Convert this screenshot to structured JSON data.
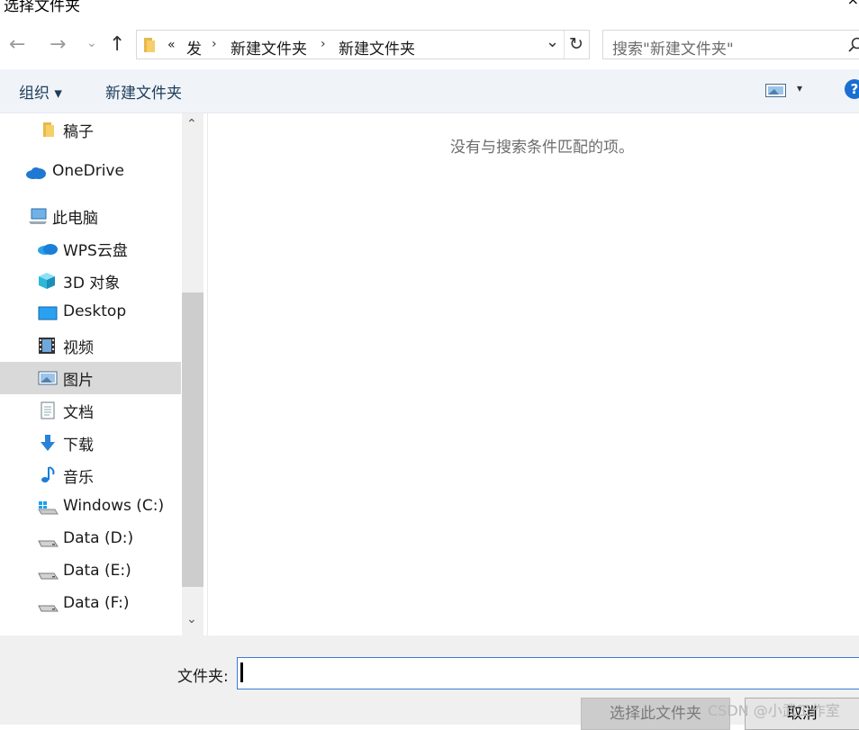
{
  "window": {
    "title": "选择文件夹",
    "close": "×"
  },
  "nav": {
    "back": "←",
    "forward": "→",
    "recent": "⌄",
    "up": "↑"
  },
  "breadcrumb": {
    "overflow": "«",
    "items": [
      "发",
      "新建文件夹",
      "新建文件夹"
    ],
    "sep": "›",
    "dropdown": "⌄",
    "refresh": "↻"
  },
  "search": {
    "placeholder": "搜索\"新建文件夹\""
  },
  "toolbar": {
    "organize_label": "组织 ▾",
    "new_folder_label": "新建文件夹",
    "view_menu": "▾",
    "help": "?"
  },
  "sidebar": {
    "items": [
      {
        "label": "稿子",
        "icon": "folder-icon"
      },
      {
        "label": "OneDrive",
        "icon": "cloud-icon"
      },
      {
        "label": "此电脑",
        "icon": "computer-icon"
      },
      {
        "label": "WPS云盘",
        "icon": "wps-cloud-icon"
      },
      {
        "label": "3D 对象",
        "icon": "cube-icon"
      },
      {
        "label": "Desktop",
        "icon": "desktop-icon"
      },
      {
        "label": "视频",
        "icon": "video-icon"
      },
      {
        "label": "图片",
        "icon": "picture-icon"
      },
      {
        "label": "文档",
        "icon": "document-icon"
      },
      {
        "label": "下载",
        "icon": "download-icon"
      },
      {
        "label": "音乐",
        "icon": "music-icon"
      },
      {
        "label": "Windows (C:)",
        "icon": "windows-drive-icon"
      },
      {
        "label": "Data (D:)",
        "icon": "drive-icon"
      },
      {
        "label": "Data (E:)",
        "icon": "drive-icon"
      },
      {
        "label": "Data (F:)",
        "icon": "drive-icon"
      }
    ],
    "selected": "图片",
    "scroll_up": "⌃",
    "scroll_down": "⌄"
  },
  "content": {
    "empty_message": "没有与搜索条件匹配的项。"
  },
  "footer": {
    "folder_label": "文件夹:",
    "folder_value": "",
    "select_button": "选择此文件夹",
    "cancel_button": "取消"
  },
  "watermark": "CSDN @小武工作室",
  "colors": {
    "accent": "#1a6fd0",
    "selected_bg": "#d9d9d9",
    "toolbar_bg": "#f0f4f9"
  }
}
